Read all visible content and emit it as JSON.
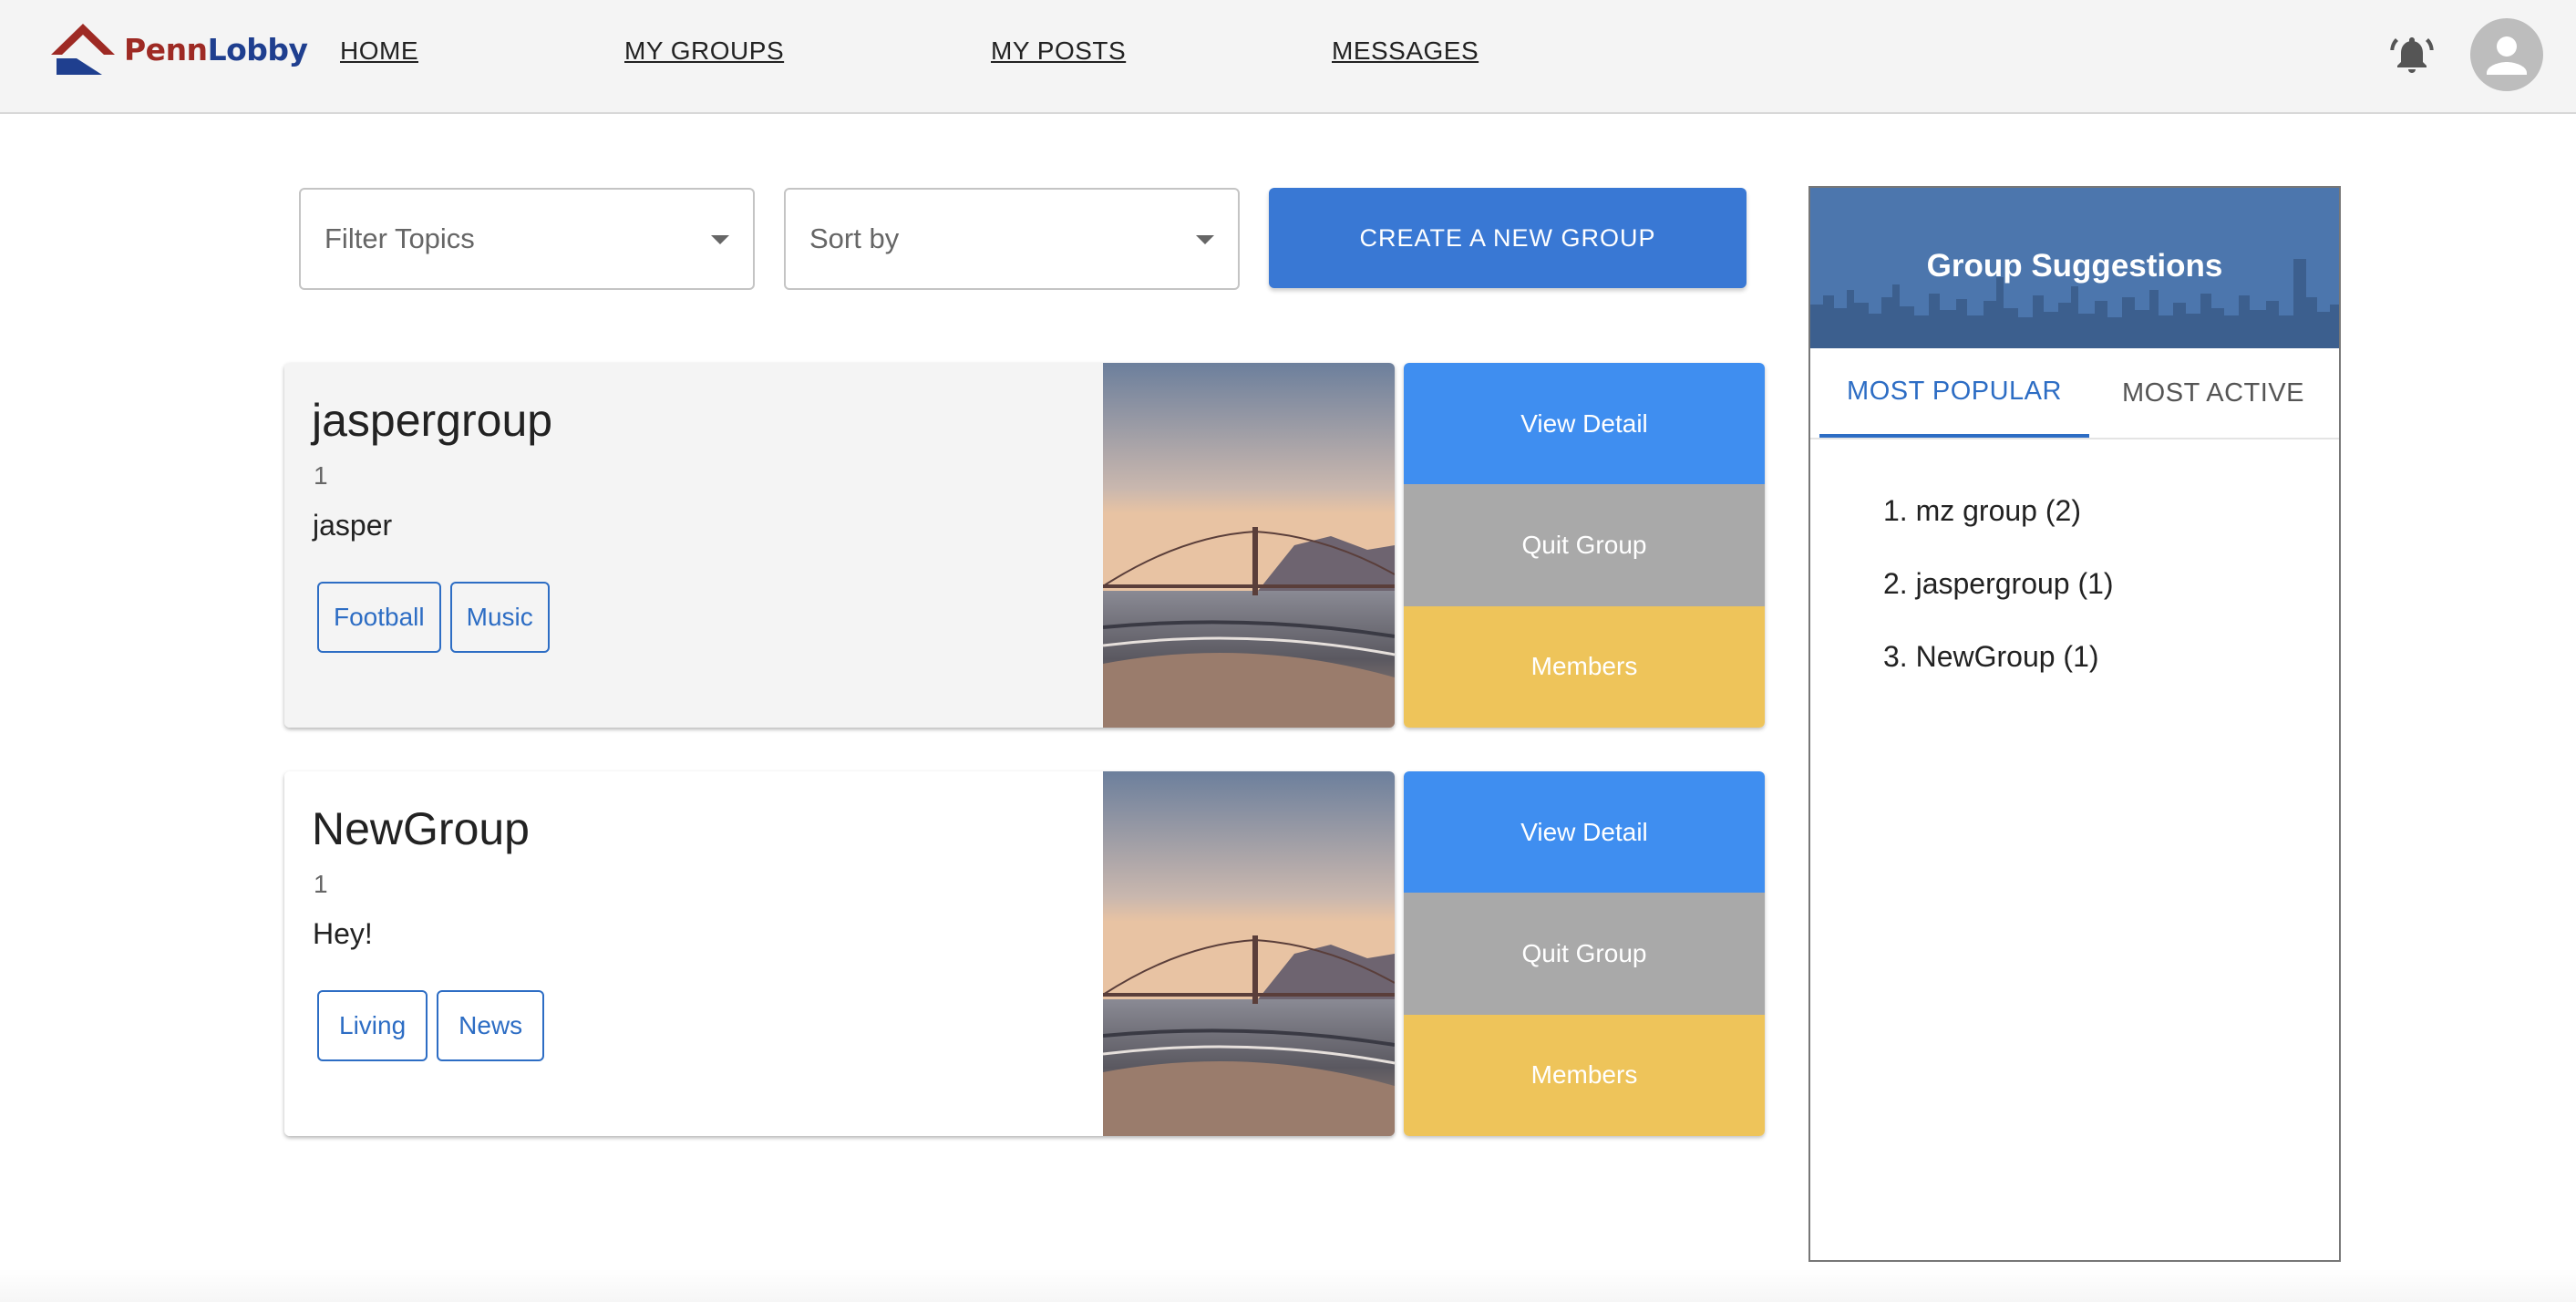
{
  "header": {
    "logo": {
      "part1": "Penn",
      "part2": "Lobby"
    },
    "nav": [
      {
        "label": "HOME"
      },
      {
        "label": "MY GROUPS"
      },
      {
        "label": "MY POSTS"
      },
      {
        "label": "MESSAGES"
      }
    ],
    "icons": {
      "notifications": "bell-icon",
      "account": "avatar-icon"
    }
  },
  "controls": {
    "filter_placeholder": "Filter Topics",
    "sort_placeholder": "Sort by",
    "create_label": "CREATE A NEW GROUP"
  },
  "groups": [
    {
      "name": "jaspergroup",
      "count": "1",
      "description": "jasper",
      "tags": [
        "Football",
        "Music"
      ],
      "view_label": "View Detail",
      "quit_label": "Quit Group",
      "members_label": "Members"
    },
    {
      "name": "NewGroup",
      "count": "1",
      "description": "Hey!",
      "tags": [
        "Living",
        "News"
      ],
      "view_label": "View Detail",
      "quit_label": "Quit Group",
      "members_label": "Members"
    }
  ],
  "suggestions": {
    "title": "Group Suggestions",
    "tabs": [
      {
        "label": "MOST POPULAR",
        "active": true
      },
      {
        "label": "MOST ACTIVE",
        "active": false
      }
    ],
    "items": [
      "1. mz group (2)",
      "2. jaspergroup (1)",
      "3. NewGroup (1)"
    ]
  },
  "colors": {
    "primary": "#3978d4",
    "view": "#3f8ef0",
    "quit": "#a9a9a9",
    "members": "#eec45a",
    "chip": "#2d6dc4",
    "logo_red": "#9e2a24",
    "logo_blue": "#1f3f8f"
  }
}
